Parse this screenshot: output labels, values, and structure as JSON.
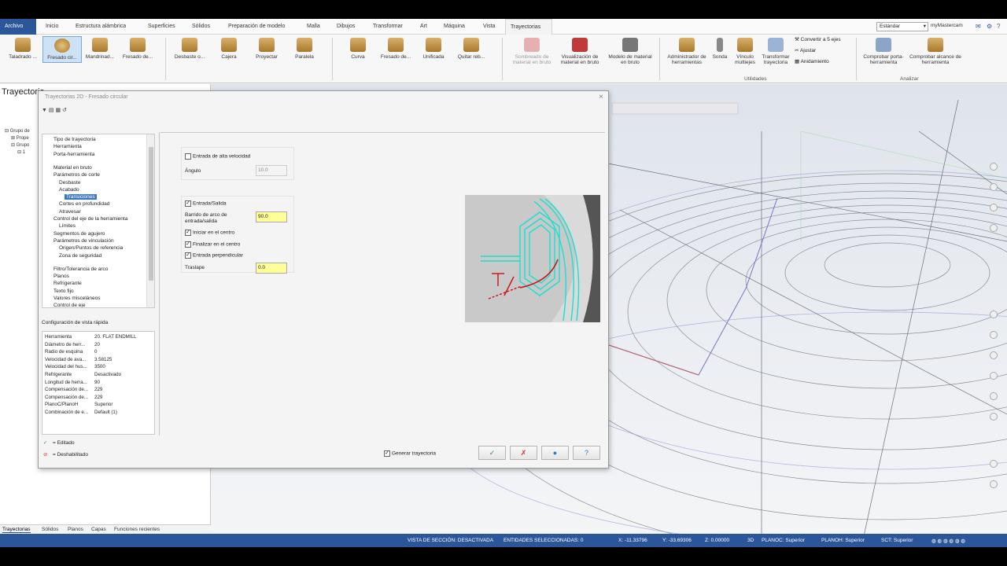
{
  "ribbon_tabs": [
    "Archivo",
    "Inicio",
    "Estructura alámbrica",
    "Superficies",
    "Sólidos",
    "Preparación de modelo",
    "Malla",
    "Dibujos",
    "Transformar",
    "Art",
    "Máquina",
    "Vista",
    "Trayectorias"
  ],
  "top_right": {
    "standard_select": "Estándar",
    "account": "myMastercam"
  },
  "ribbon_buttons": {
    "taladrado": "Taladrado ...",
    "fresado_cir": "Fresado cir...",
    "mandrinado": "Mandrinad...",
    "fresado_de1": "Fresado de...",
    "desbaste": "Desbaste o...",
    "cajera": "Cajera",
    "proyectar": "Proyectar",
    "paralela": "Paralela",
    "curva": "Curva",
    "fresado_de2": "Fresado de...",
    "unificada": "Unificada",
    "quitar_reb": "Quitar reb...",
    "sombreado": "Sombreado de material en bruto",
    "visualizacion": "Visualización de material en bruto",
    "modelo": "Modelo de material en bruto",
    "administrador": "Administrador de herramientas",
    "sonda": "Sonda",
    "vinculo": "Vínculo multiejes",
    "transformar": "Transformar trayectoria",
    "convertir": "Convertir a 5 ejes",
    "ajustar": "Ajustar",
    "anidamiento": "Anidamiento",
    "comprobar_porta": "Comprobar porta-herramienta",
    "comprobar_alcance": "Comprobar alcance de herramienta"
  },
  "ribbon_groups": {
    "utilidades": "Utilidades",
    "analizar": "Analizar"
  },
  "left_panel": {
    "title": "Trayectoria",
    "tree": [
      "Grupo de",
      "Prope",
      "Grupo",
      "1"
    ]
  },
  "dialog": {
    "title": "Trayectorias 2D - Fresado circular",
    "tree_items": [
      {
        "label": "Tipo de trayectoria",
        "indent": 0
      },
      {
        "label": "Herramienta",
        "indent": 0
      },
      {
        "label": "Porta-herramienta",
        "indent": 0
      },
      {
        "label": "Material en bruto",
        "indent": 0
      },
      {
        "label": "Parámetros de corte",
        "indent": 0
      },
      {
        "label": "Desbaste",
        "indent": 1
      },
      {
        "label": "Acabado",
        "indent": 1
      },
      {
        "label": "Transiciones",
        "indent": 2,
        "selected": true
      },
      {
        "label": "Cortes en profundidad",
        "indent": 1
      },
      {
        "label": "Atravesar",
        "indent": 1
      },
      {
        "label": "Control del eje de la herramienta",
        "indent": 0
      },
      {
        "label": "Límites",
        "indent": 1
      },
      {
        "label": "Segmentos de agujero",
        "indent": 0
      },
      {
        "label": "Parámetros de vinculación",
        "indent": 0
      },
      {
        "label": "Origen/Puntos de referencia",
        "indent": 1
      },
      {
        "label": "Zona de seguridad",
        "indent": 1
      },
      {
        "label": "Filtro/Tolerancia de arco",
        "indent": 0
      },
      {
        "label": "Planos",
        "indent": 0
      },
      {
        "label": "Refrigerante",
        "indent": 0
      },
      {
        "label": "Texto fijo",
        "indent": 0
      },
      {
        "label": "Valores misceláneos",
        "indent": 0
      },
      {
        "label": "Control de eje",
        "indent": 0
      }
    ],
    "quick_view_title": "Configuración de vista rápida",
    "quick_view": [
      {
        "k": "Herramienta",
        "v": "20. FLAT ENDMILL"
      },
      {
        "k": "Diámetro de herr...",
        "v": "20"
      },
      {
        "k": "Radio de esquina",
        "v": "0"
      },
      {
        "k": "Velocidad de ava...",
        "v": "3.58125"
      },
      {
        "k": "Velocidad del hus...",
        "v": "3500"
      },
      {
        "k": "Refrigerante",
        "v": "Desactivado"
      },
      {
        "k": "Longitud de herra...",
        "v": "90"
      },
      {
        "k": "Compensación de...",
        "v": "229"
      },
      {
        "k": "Compensación de...",
        "v": "229"
      },
      {
        "k": "PlanoC/PlanoH",
        "v": "Superior"
      },
      {
        "k": "Combinación de e...",
        "v": "Default (1)"
      }
    ],
    "legend_edited": "= Editado",
    "legend_disabled": "= Deshabilitado",
    "high_speed_entry": "Entrada de alta velocidad",
    "angle_label": "Ángulo",
    "angle_value": "10.0",
    "entry_exit": "Entrada/Salida",
    "arc_sweep_label": "Barrido de arco de entrada/salida",
    "arc_sweep_value": "90.0",
    "start_center": "Iniciar en el centro",
    "end_center": "Finalizar en el centro",
    "perp_entry": "Entrada perpendicular",
    "overlap_label": "Traslape",
    "overlap_value": "0.0",
    "generate_toolpath": "Generar trayectoria",
    "btn_ok": "✓",
    "btn_cancel": "✗",
    "btn_apply": "●",
    "btn_help": "?"
  },
  "bottom_tabs": [
    "Trayectorias",
    "Sólidos",
    "Planos",
    "Capas",
    "Funciones recientes"
  ],
  "status": {
    "section_view": "VISTA DE SECCIÓN: DESACTIVADA",
    "selected": "ENTIDADES SELECCIONADAS: 0",
    "x": "X: -11.33796",
    "y": "Y: -33.69306",
    "z": "Z: 0.00000",
    "mode": "3D",
    "planec": "PLANOC: Superior",
    "planeh": "PLANOH: Superior",
    "sct": "SCT: Superior"
  },
  "colors": {
    "accent": "#2b579a",
    "highlight_field": "#ffff9a",
    "toolpath": "#19e0d0"
  }
}
